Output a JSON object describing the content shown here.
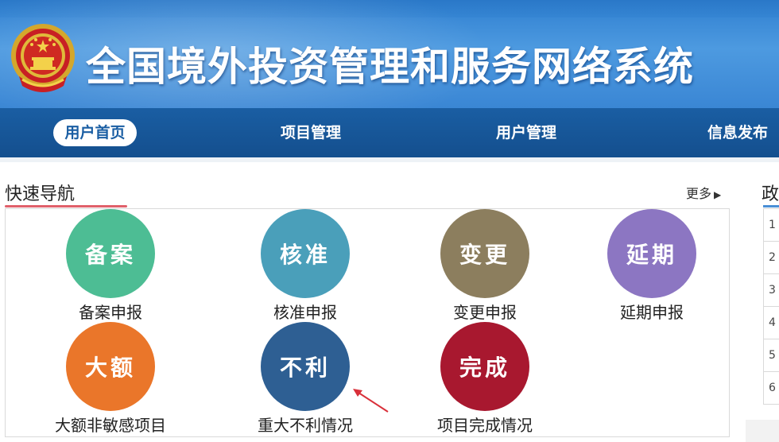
{
  "header": {
    "site_title": "全国境外投资管理和服务网络系统"
  },
  "nav": {
    "items": [
      {
        "label": "用户首页",
        "active": true
      },
      {
        "label": "项目管理",
        "active": false
      },
      {
        "label": "用户管理",
        "active": false
      },
      {
        "label": "信息发布",
        "active": false
      }
    ]
  },
  "quick_nav": {
    "title": "快速导航",
    "more": "更多",
    "tiles": [
      {
        "icon_text": "备案",
        "label": "备案申报",
        "color": "#4dbd94"
      },
      {
        "icon_text": "核准",
        "label": "核准申报",
        "color": "#4a9fba"
      },
      {
        "icon_text": "变更",
        "label": "变更申报",
        "color": "#8c7e5e"
      },
      {
        "icon_text": "延期",
        "label": "延期申报",
        "color": "#8c76c2"
      },
      {
        "icon_text": "大额",
        "label": "大额非敏感项目",
        "color": "#ea762a"
      },
      {
        "icon_text": "不利",
        "label": "重大不利情况",
        "color": "#2e5f93"
      },
      {
        "icon_text": "完成",
        "label": "项目完成情况",
        "color": "#a8182f"
      }
    ]
  },
  "right_panel": {
    "title": "政",
    "rows": [
      "1",
      "2",
      "3",
      "4",
      "5",
      "6"
    ]
  },
  "colors": {
    "header_blue": "#3a86d4",
    "nav_blue": "#1a5ea3",
    "accent_red": "#e0606b",
    "annotation_red": "#d9303a"
  }
}
